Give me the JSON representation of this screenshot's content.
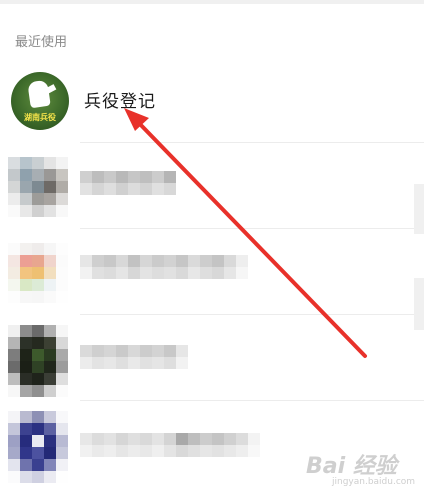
{
  "recent": {
    "header": "最近使用",
    "items": [
      {
        "name": "兵役登记",
        "badge_text": "湖南兵役",
        "avatar_icon": "soldier-emblem"
      }
    ]
  },
  "watermark": {
    "text": "Bai 经验",
    "sub": "jingyan.baidu.com"
  },
  "annotation_color": "#e8312a"
}
